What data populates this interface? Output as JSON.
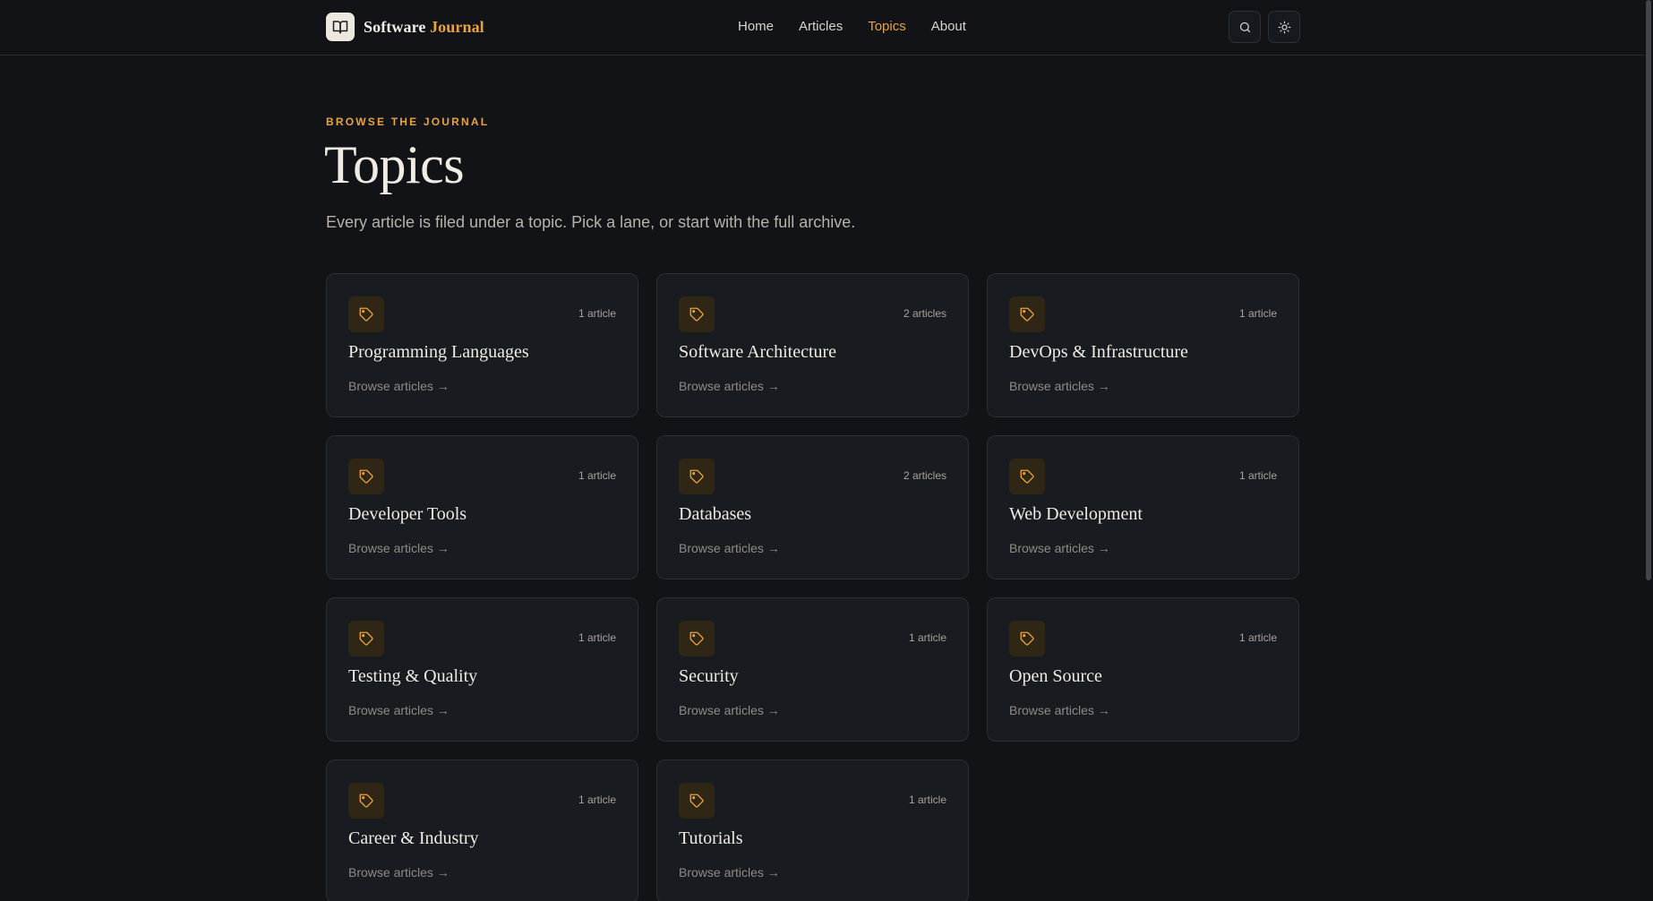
{
  "brand": {
    "name_part1": "Software",
    "name_part2": "Journal",
    "logo_icon": "book-open-icon"
  },
  "nav": {
    "items": [
      {
        "label": "Home",
        "active": false
      },
      {
        "label": "Articles",
        "active": false
      },
      {
        "label": "Topics",
        "active": true
      },
      {
        "label": "About",
        "active": false
      }
    ]
  },
  "header_actions": {
    "search_icon": "search-icon",
    "theme_icon": "sun-icon"
  },
  "hero": {
    "eyebrow": "BROWSE THE JOURNAL",
    "title": "Topics",
    "subtitle": "Every article is filed under a topic. Pick a lane, or start with the full archive."
  },
  "topics": [
    {
      "title": "Programming Languages",
      "count": "1 article",
      "link": "Browse articles →"
    },
    {
      "title": "Software Architecture",
      "count": "2 articles",
      "link": "Browse articles →"
    },
    {
      "title": "DevOps & Infrastructure",
      "count": "1 article",
      "link": "Browse articles →"
    },
    {
      "title": "Developer Tools",
      "count": "1 article",
      "link": "Browse articles →"
    },
    {
      "title": "Databases",
      "count": "2 articles",
      "link": "Browse articles →"
    },
    {
      "title": "Web Development",
      "count": "1 article",
      "link": "Browse articles →"
    },
    {
      "title": "Testing & Quality",
      "count": "1 article",
      "link": "Browse articles →"
    },
    {
      "title": "Security",
      "count": "1 article",
      "link": "Browse articles →"
    },
    {
      "title": "Open Source",
      "count": "1 article",
      "link": "Browse articles →"
    },
    {
      "title": "Career & Industry",
      "count": "1 article",
      "link": "Browse articles →"
    },
    {
      "title": "Tutorials",
      "count": "1 article",
      "link": "Browse articles →"
    }
  ],
  "colors": {
    "accent": "#e8a33d",
    "background": "#111317",
    "card": "#181b20"
  }
}
